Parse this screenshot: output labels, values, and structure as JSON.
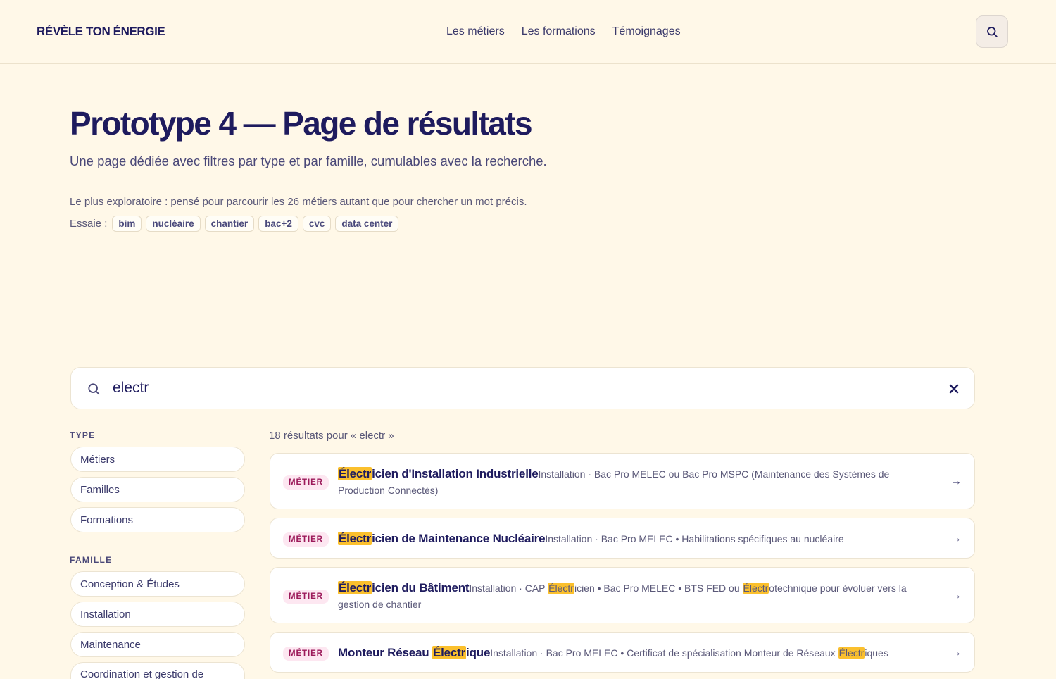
{
  "header": {
    "logo": "RÉVÈLE TON ÉNERGIE",
    "nav": [
      "Les métiers",
      "Les formations",
      "Témoignages"
    ]
  },
  "hero": {
    "title": "Prototype 4 — Page de résultats",
    "subtitle": "Une page dédiée avec filtres par type et par famille, cumulables avec la recherche.",
    "note": "Le plus exploratoire : pensé pour parcourir les 26 métiers autant que pour chercher un mot précis.",
    "try_label": "Essaie :",
    "suggestions": [
      "bim",
      "nucléaire",
      "chantier",
      "bac+2",
      "cvc",
      "data center"
    ]
  },
  "search": {
    "query": "electr"
  },
  "filters": {
    "type_label": "TYPE",
    "types": [
      "Métiers",
      "Familles",
      "Formations"
    ],
    "famille_label": "FAMILLE",
    "familles": [
      "Conception & Études",
      "Installation",
      "Maintenance",
      "Coordination et gestion de"
    ]
  },
  "results": {
    "count_text": "18 résultats pour « electr »",
    "items": [
      {
        "badge": "MÉTIER",
        "title_hl": "Électr",
        "title_rest": "icien d'Installation Industrielle",
        "desc": "Installation · Bac Pro MELEC ou Bac Pro MSPC (Maintenance des Systèmes de Production Connectés)"
      },
      {
        "badge": "MÉTIER",
        "title_hl": "Électr",
        "title_rest": "icien de Maintenance Nucléaire",
        "desc": "Installation · Bac Pro MELEC • Habilitations spécifiques au nucléaire"
      },
      {
        "badge": "MÉTIER",
        "title_hl": "Électr",
        "title_rest": "icien du Bâtiment",
        "desc_a": "Installation · CAP ",
        "desc_hl1": "Électr",
        "desc_b": "icien • Bac Pro MELEC • BTS FED ou ",
        "desc_hl2": "Électr",
        "desc_c": "otechnique pour évoluer vers la gestion de chantier"
      },
      {
        "badge": "MÉTIER",
        "title_pre": "Monteur Réseau ",
        "title_hl": "Électr",
        "title_rest": "ique",
        "desc_a": "Installation · Bac Pro MELEC • Certificat de spécialisation Monteur de Réseaux ",
        "desc_hl": "Électr",
        "desc_b": "iques"
      }
    ]
  },
  "icons": {
    "search": "search-icon",
    "clear": "close-icon",
    "arrow": "→"
  },
  "colors": {
    "background": "#fff8e8",
    "ink": "#1e1b5e",
    "highlight": "#fbc02d",
    "badge_bg": "#fde7f1",
    "badge_text": "#9c1a5a"
  }
}
